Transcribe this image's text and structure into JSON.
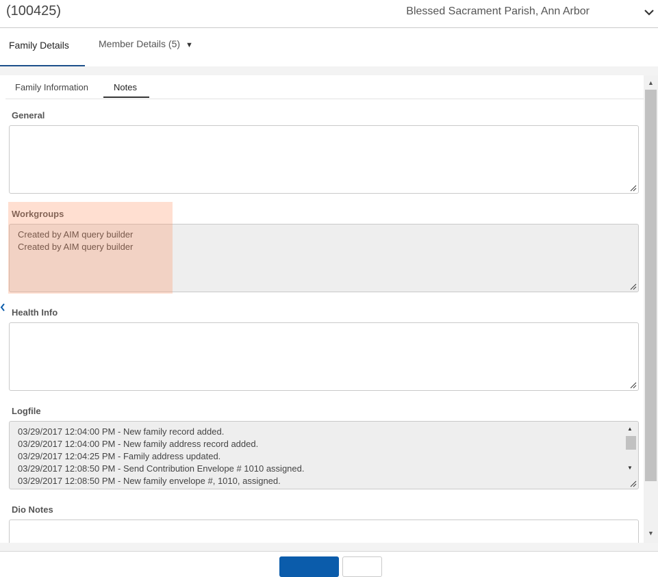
{
  "header": {
    "record_id": "(100425)",
    "parish": "Blessed Sacrament Parish, Ann Arbor"
  },
  "main_tabs": {
    "family_details": "Family Details",
    "member_details": "Member Details (5)"
  },
  "sub_tabs": {
    "family_information": "Family Information",
    "notes": "Notes"
  },
  "fields": {
    "general": {
      "label": "General",
      "value": ""
    },
    "workgroups": {
      "label": "Workgroups",
      "lines": [
        "Created by AIM query builder",
        "Created by AIM query builder"
      ]
    },
    "health_info": {
      "label": "Health Info",
      "value": ""
    },
    "logfile": {
      "label": "Logfile",
      "lines": [
        "03/29/2017 12:04:00 PM - New family record added.",
        "03/29/2017 12:04:00 PM - New family address record added.",
        "03/29/2017 12:04:25 PM - Family address updated.",
        "03/29/2017 12:08:50 PM - Send Contribution Envelope # 1010 assigned.",
        "03/29/2017 12:08:50 PM - New family envelope #, 1010, assigned."
      ]
    },
    "dio_notes": {
      "label": "Dio Notes",
      "value": ""
    }
  },
  "footer": {
    "primary_button": "",
    "secondary_button": ""
  },
  "colors": {
    "primary": "#0b5cab",
    "tab_underline": "#1b4f8a",
    "highlight": "#ffb08c"
  }
}
